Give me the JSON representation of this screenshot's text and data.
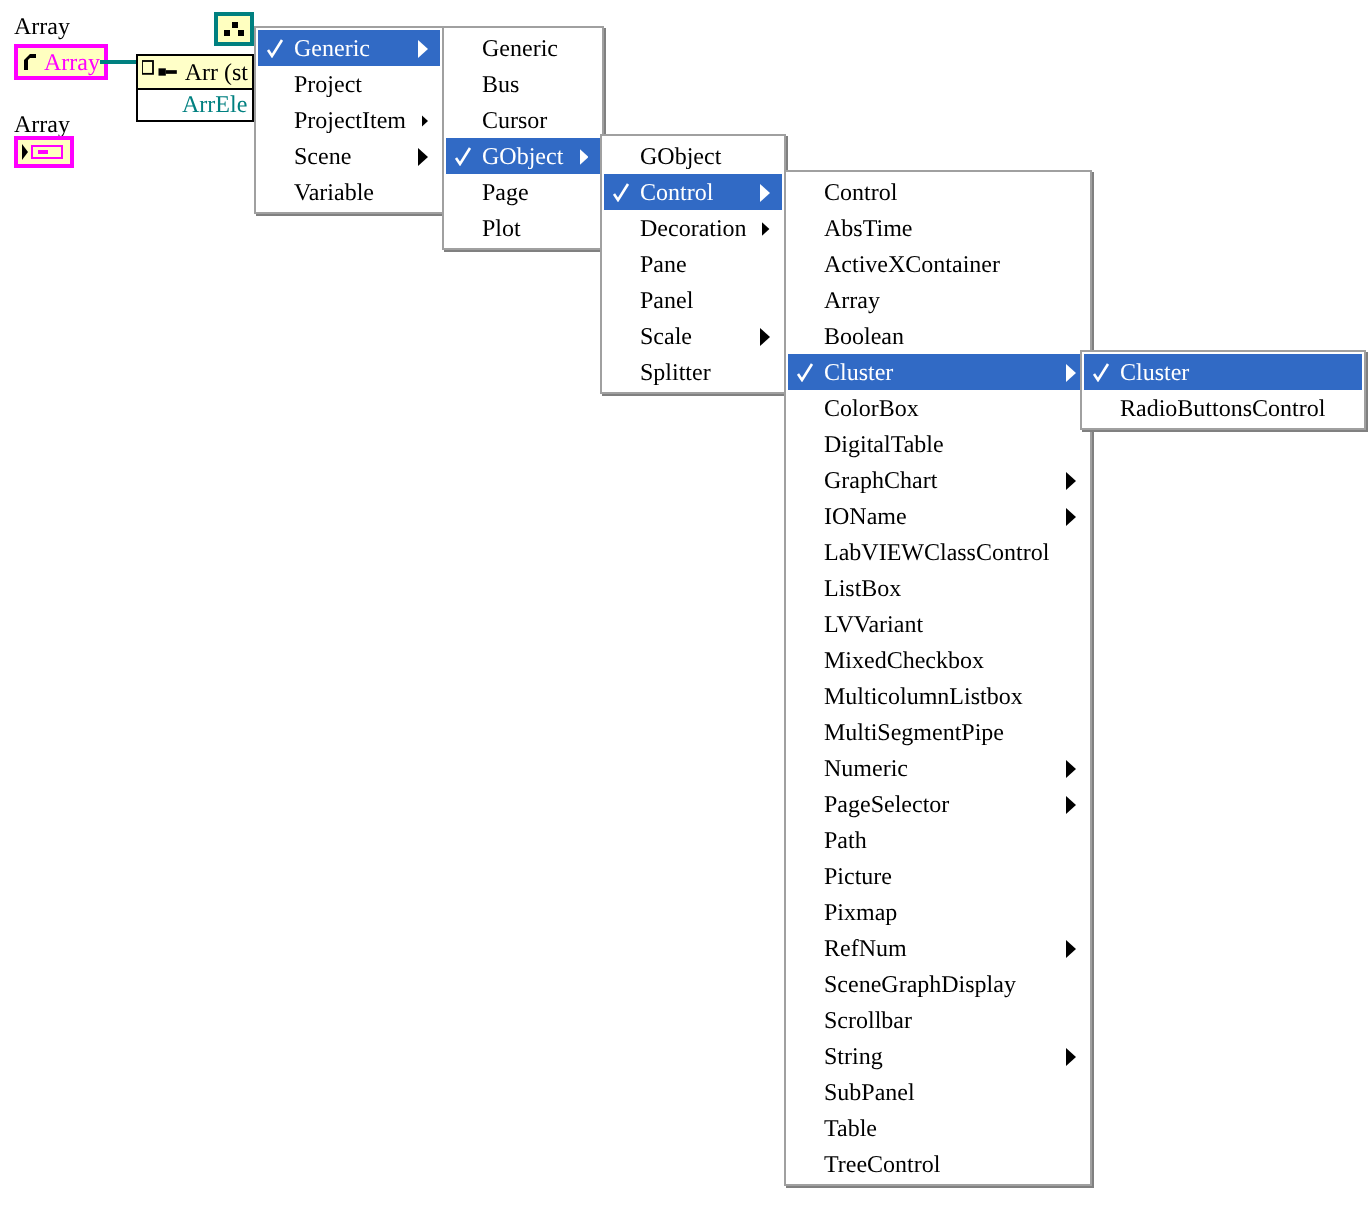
{
  "diagram": {
    "control": {
      "label": "Array",
      "text": "Array"
    },
    "node": {
      "title": "Arr (st",
      "field": "ArrEle"
    },
    "constant": {
      "label": "Array"
    }
  },
  "menus": [
    {
      "items": [
        {
          "label": "Generic",
          "selected": true,
          "submenu": true
        },
        {
          "label": "Project",
          "selected": false,
          "submenu": false
        },
        {
          "label": "ProjectItem",
          "selected": false,
          "submenu": true
        },
        {
          "label": "Scene",
          "selected": false,
          "submenu": true
        },
        {
          "label": "Variable",
          "selected": false,
          "submenu": false
        }
      ]
    },
    {
      "items": [
        {
          "label": "Generic",
          "selected": false,
          "submenu": false
        },
        {
          "label": "Bus",
          "selected": false,
          "submenu": false
        },
        {
          "label": "Cursor",
          "selected": false,
          "submenu": false
        },
        {
          "label": "GObject",
          "selected": true,
          "submenu": true
        },
        {
          "label": "Page",
          "selected": false,
          "submenu": false
        },
        {
          "label": "Plot",
          "selected": false,
          "submenu": false
        }
      ]
    },
    {
      "items": [
        {
          "label": "GObject",
          "selected": false,
          "submenu": false
        },
        {
          "label": "Control",
          "selected": true,
          "submenu": true
        },
        {
          "label": "Decoration",
          "selected": false,
          "submenu": true
        },
        {
          "label": "Pane",
          "selected": false,
          "submenu": false
        },
        {
          "label": "Panel",
          "selected": false,
          "submenu": false
        },
        {
          "label": "Scale",
          "selected": false,
          "submenu": true
        },
        {
          "label": "Splitter",
          "selected": false,
          "submenu": false
        }
      ]
    },
    {
      "items": [
        {
          "label": "Control",
          "selected": false,
          "submenu": false
        },
        {
          "label": "AbsTime",
          "selected": false,
          "submenu": false
        },
        {
          "label": "ActiveXContainer",
          "selected": false,
          "submenu": false
        },
        {
          "label": "Array",
          "selected": false,
          "submenu": false
        },
        {
          "label": "Boolean",
          "selected": false,
          "submenu": false
        },
        {
          "label": "Cluster",
          "selected": true,
          "submenu": true
        },
        {
          "label": "ColorBox",
          "selected": false,
          "submenu": false
        },
        {
          "label": "DigitalTable",
          "selected": false,
          "submenu": false
        },
        {
          "label": "GraphChart",
          "selected": false,
          "submenu": true
        },
        {
          "label": "IOName",
          "selected": false,
          "submenu": true
        },
        {
          "label": "LabVIEWClassControl",
          "selected": false,
          "submenu": false
        },
        {
          "label": "ListBox",
          "selected": false,
          "submenu": false
        },
        {
          "label": "LVVariant",
          "selected": false,
          "submenu": false
        },
        {
          "label": "MixedCheckbox",
          "selected": false,
          "submenu": false
        },
        {
          "label": "MulticolumnListbox",
          "selected": false,
          "submenu": false
        },
        {
          "label": "MultiSegmentPipe",
          "selected": false,
          "submenu": false
        },
        {
          "label": "Numeric",
          "selected": false,
          "submenu": true
        },
        {
          "label": "PageSelector",
          "selected": false,
          "submenu": true
        },
        {
          "label": "Path",
          "selected": false,
          "submenu": false
        },
        {
          "label": "Picture",
          "selected": false,
          "submenu": false
        },
        {
          "label": "Pixmap",
          "selected": false,
          "submenu": false
        },
        {
          "label": "RefNum",
          "selected": false,
          "submenu": true
        },
        {
          "label": "SceneGraphDisplay",
          "selected": false,
          "submenu": false
        },
        {
          "label": "Scrollbar",
          "selected": false,
          "submenu": false
        },
        {
          "label": "String",
          "selected": false,
          "submenu": true
        },
        {
          "label": "SubPanel",
          "selected": false,
          "submenu": false
        },
        {
          "label": "Table",
          "selected": false,
          "submenu": false
        },
        {
          "label": "TreeControl",
          "selected": false,
          "submenu": false
        }
      ]
    },
    {
      "items": [
        {
          "label": "Cluster",
          "selected": true,
          "submenu": false
        },
        {
          "label": "RadioButtonsControl",
          "selected": false,
          "submenu": false
        }
      ]
    }
  ]
}
